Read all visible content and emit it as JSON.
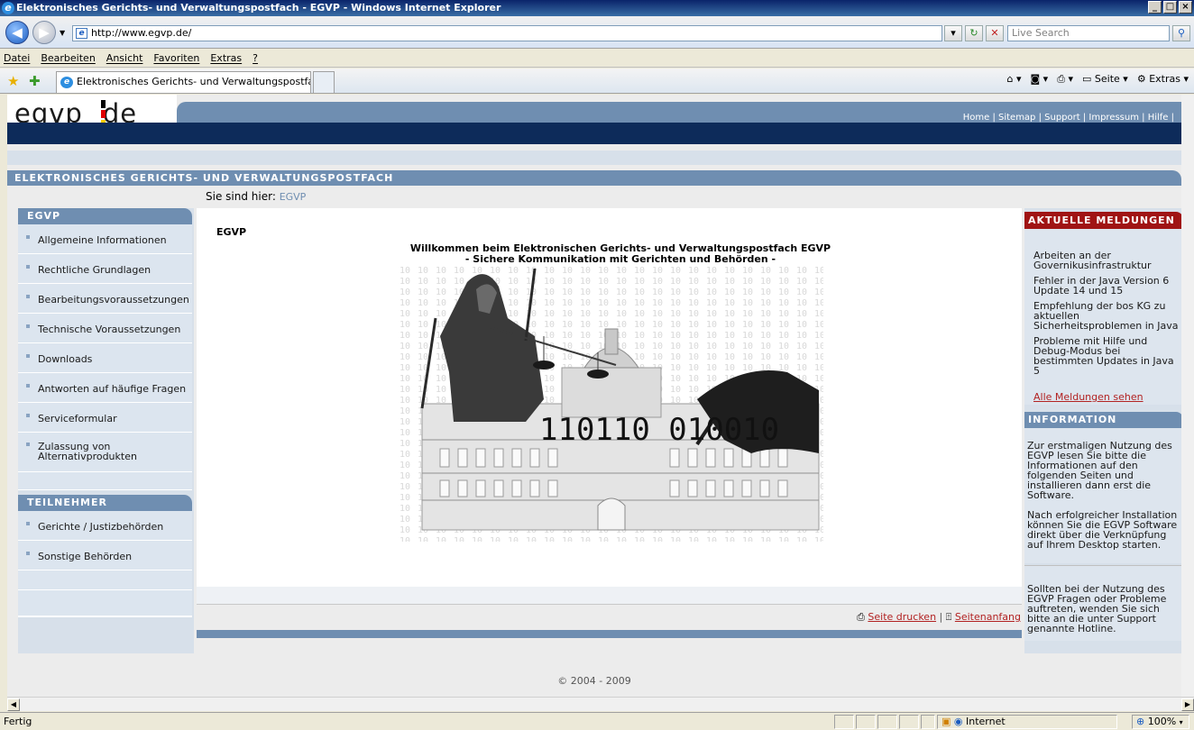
{
  "window": {
    "title": "Elektronisches Gerichts- und Verwaltungspostfach - EGVP - Windows Internet Explorer",
    "min_label": "_",
    "max_label": "□",
    "close_label": "×"
  },
  "toolbar": {
    "address": "http://www.egvp.de/",
    "search_placeholder": "Live Search"
  },
  "menu": {
    "items": [
      "Datei",
      "Bearbeiten",
      "Ansicht",
      "Favoriten",
      "Extras",
      "?"
    ]
  },
  "tab": {
    "title": "Elektronisches Gerichts- und Verwaltungspostfach - E...",
    "commands": [
      "Seite",
      "Extras"
    ]
  },
  "header": {
    "logo": "egvp de",
    "logo_left": "egvp",
    "logo_right": "de",
    "links": "Home | Sitemap | Support | Impressum | Hilfe |",
    "site_title": "ELEKTRONISCHES GERICHTS- UND VERWALTUNGSPOSTFACH"
  },
  "breadcrumb": {
    "label": "Sie sind hier:",
    "current": "EGVP"
  },
  "leftnav": {
    "heading1": "EGVP",
    "items1": [
      "Allgemeine Informationen",
      "Rechtliche Grundlagen",
      "Bearbeitungsvoraussetzungen",
      "Technische Voraussetzungen",
      "Downloads",
      "Antworten auf häufige Fragen",
      "Serviceformular",
      "Zulassung von Alternativprodukten"
    ],
    "heading2": "TEILNEHMER",
    "items2": [
      "Gerichte / Justizbehörden",
      "Sonstige Behörden"
    ]
  },
  "main": {
    "heading": "EGVP",
    "welcome_line1": "Willkommen beim Elektronischen Gerichts- und Verwaltungspostfach EGVP",
    "welcome_line2": "- Sichere Kommunikation mit Gerichten und Behörden -",
    "hero_binary": "110110 010010",
    "print_link": "Seite drucken",
    "top_link": "Seitenanfang"
  },
  "rightcol": {
    "news_heading": "AKTUELLE MELDUNGEN",
    "news": [
      "Arbeiten an der Governikusinfrastruktur",
      "Fehler in der Java Version 6 Update 14 und 15",
      "Empfehlung der bos KG zu aktuellen Sicherheitsproblemen in Java",
      "Probleme mit Hilfe und Debug-Modus bei bestimmten Updates in Java 5"
    ],
    "news_all": "Alle Meldungen sehen",
    "info_heading": "INFORMATION",
    "info_p1": "Zur erstmaligen Nutzung des EGVP lesen Sie bitte die Informationen auf den folgenden Seiten und installieren dann erst die Software.",
    "info_p2": "Nach erfolgreicher Installation können Sie die EGVP Software direkt über die Verknüpfung auf Ihrem Desktop starten.",
    "info_p3": "Sollten bei der Nutzung des EGVP Fragen oder Probleme auftreten, wenden Sie sich bitte an die unter Support genannte Hotline."
  },
  "footer": {
    "copyright": "© 2004 - 2009"
  },
  "statusbar": {
    "status": "Fertig",
    "zone": "Internet",
    "zoom": "100%"
  },
  "colors": {
    "brand_blue": "#6f8eb1",
    "navy": "#0d2b5a",
    "news_red": "#a01414"
  }
}
